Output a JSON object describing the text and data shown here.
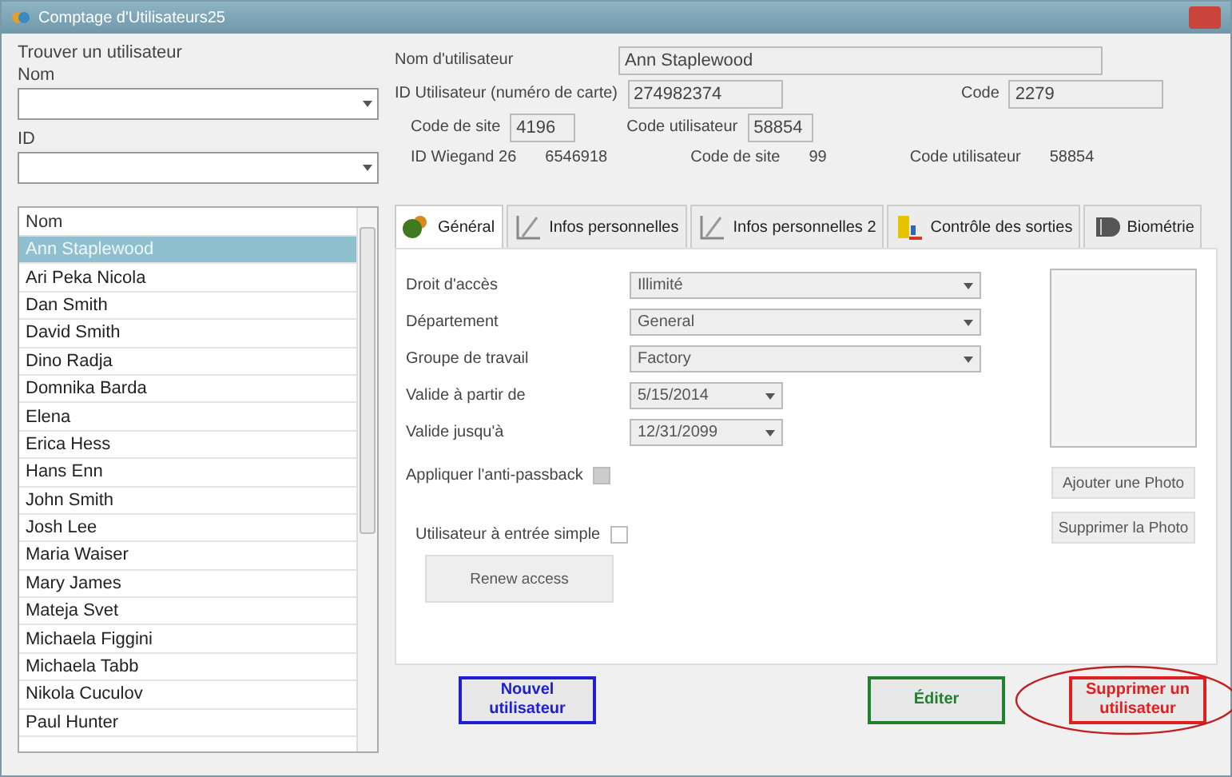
{
  "window": {
    "title": "Comptage d'Utilisateurs25"
  },
  "search": {
    "title": "Trouver un utilisateur",
    "name_label": "Nom",
    "id_label": "ID"
  },
  "user_list": {
    "header": "Nom",
    "items": [
      {
        "name": "Ann Staplewood",
        "selected": true
      },
      {
        "name": "Ari Peka Nicola",
        "selected": false
      },
      {
        "name": "Dan Smith",
        "selected": false
      },
      {
        "name": "David Smith",
        "selected": false
      },
      {
        "name": "Dino Radja",
        "selected": false
      },
      {
        "name": "Domnika Barda",
        "selected": false
      },
      {
        "name": "Elena",
        "selected": false
      },
      {
        "name": "Erica Hess",
        "selected": false
      },
      {
        "name": "Hans Enn",
        "selected": false
      },
      {
        "name": "John Smith",
        "selected": false
      },
      {
        "name": "Josh Lee",
        "selected": false
      },
      {
        "name": "Maria Waiser",
        "selected": false
      },
      {
        "name": "Mary James",
        "selected": false
      },
      {
        "name": "Mateja Svet",
        "selected": false
      },
      {
        "name": "Michaela Figgini",
        "selected": false
      },
      {
        "name": "Michaela Tabb",
        "selected": false
      },
      {
        "name": "Nikola Cuculov",
        "selected": false
      },
      {
        "name": "Paul Hunter",
        "selected": false
      }
    ]
  },
  "user": {
    "name_label": "Nom d'utilisateur",
    "name": "Ann Staplewood",
    "card_label": "ID Utilisateur (numéro de carte)",
    "card": "274982374",
    "code_label": "Code",
    "code": "2279",
    "site_label": "Code de site",
    "site": "4196",
    "ucode_label": "Code utilisateur",
    "ucode": "58854",
    "wiegand_label": "ID Wiegand 26",
    "wiegand": "6546918",
    "w_site_label": "Code de site",
    "w_site": "99",
    "w_ucode_label": "Code utilisateur",
    "w_ucode": "58854"
  },
  "tabs": [
    {
      "label": "Général",
      "kind": "general",
      "selected": true
    },
    {
      "label": "Infos personnelles",
      "kind": "notes",
      "selected": false
    },
    {
      "label": "Infos personnelles 2",
      "kind": "notes",
      "selected": false
    },
    {
      "label": "Contrôle des sorties",
      "kind": "exit",
      "selected": false
    },
    {
      "label": "Biométrie",
      "kind": "bio",
      "selected": false
    }
  ],
  "general": {
    "fields": [
      {
        "label": "Droit d'accès",
        "value": "Illimité",
        "kind": "wide"
      },
      {
        "label": "Département",
        "value": "General",
        "kind": "wide"
      },
      {
        "label": "Groupe de travail",
        "value": "Factory",
        "kind": "wide"
      },
      {
        "label": "Valide à partir de",
        "value": "5/15/2014",
        "kind": "date"
      },
      {
        "label": "Valide jusqu'à",
        "value": "12/31/2099",
        "kind": "date"
      }
    ],
    "antipassback": {
      "label": "Appliquer l'anti-passback",
      "checked": true
    },
    "single_entry": {
      "label": "Utilisateur à entrée simple",
      "checked": false
    },
    "renew": "Renew access",
    "add_photo": "Ajouter une Photo",
    "remove_photo": "Supprimer la Photo"
  },
  "actions": [
    {
      "label": "Nouvel utilisateur",
      "color": "#2020d0",
      "highlighted": false
    },
    {
      "label": "Éditer",
      "color": "#208030",
      "highlighted": false
    },
    {
      "label": "Supprimer un utilisateur",
      "color": "#e02020",
      "highlighted": true
    }
  ]
}
